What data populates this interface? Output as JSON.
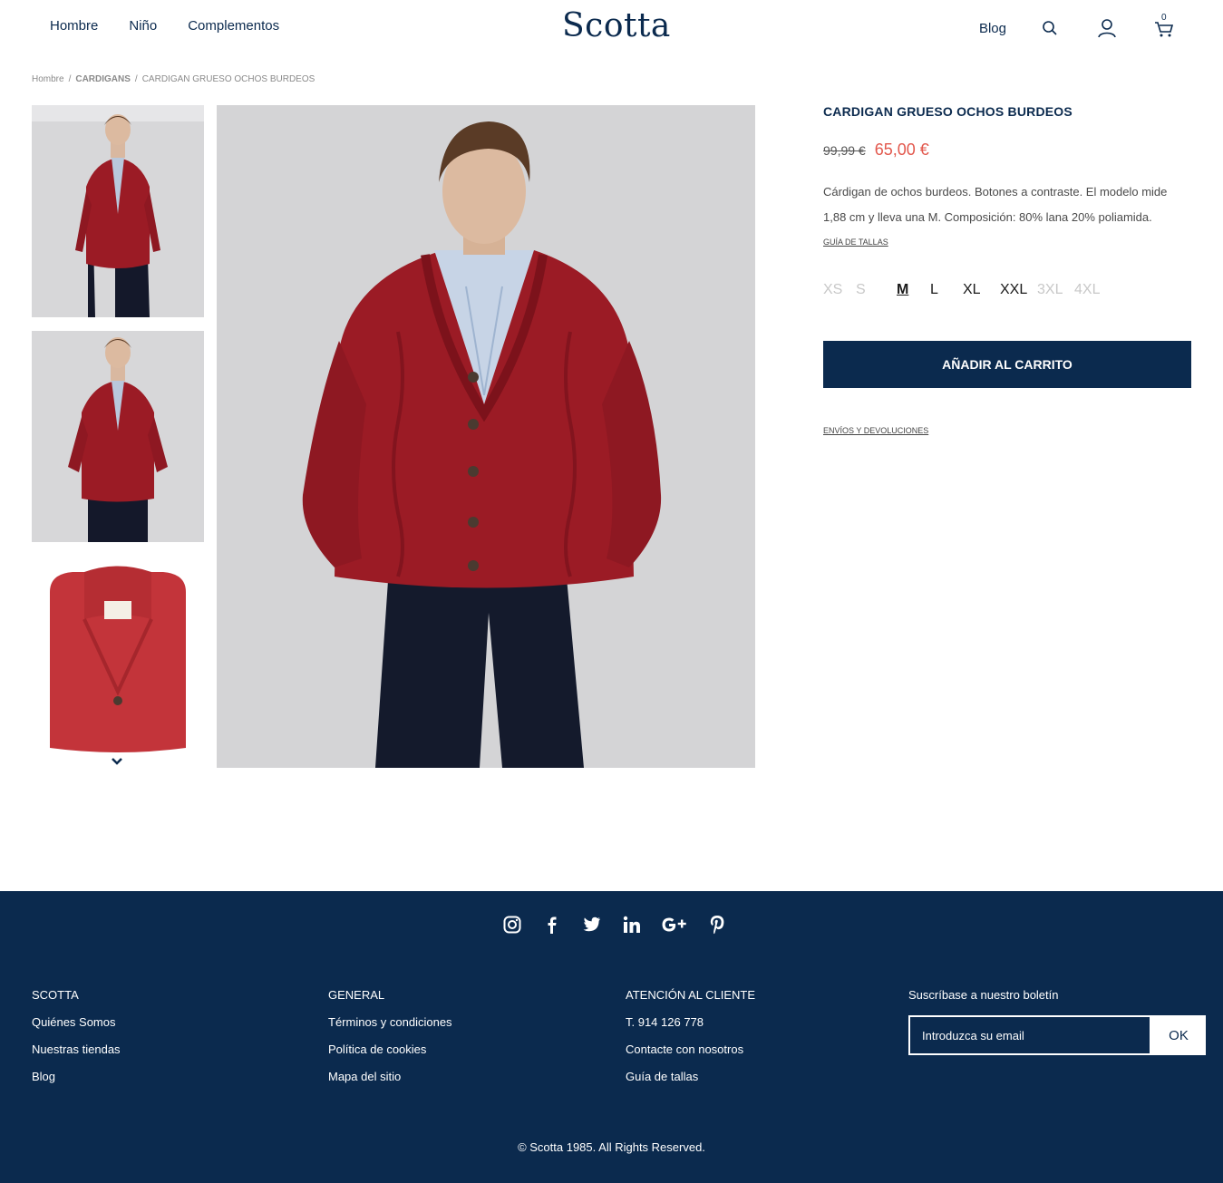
{
  "header": {
    "nav": [
      "Hombre",
      "Niño",
      "Complementos"
    ],
    "logo": "Scotta",
    "blog": "Blog",
    "cart_count": "0"
  },
  "breadcrumb": [
    "Hombre",
    "CARDIGANS",
    "CARDIGAN GRUESO OCHOS BURDEOS"
  ],
  "product": {
    "title": "CARDIGAN GRUESO OCHOS BURDEOS",
    "old_price": "99,99 €",
    "new_price": "65,00 €",
    "description": "Cárdigan de ochos burdeos. Botones a contraste. El modelo mide 1,88 cm y lleva una M. Composición: 80% lana 20% poliamida.",
    "size_guide_link": "GUÍA DE TALLAS",
    "sizes": [
      {
        "label": "XS",
        "state": "unavailable"
      },
      {
        "label": "S",
        "state": "unavailable"
      },
      {
        "label": "M",
        "state": "selected"
      },
      {
        "label": "L",
        "state": "available"
      },
      {
        "label": "XL",
        "state": "available"
      },
      {
        "label": "XXL",
        "state": "available"
      },
      {
        "label": "3XL",
        "state": "unavailable"
      },
      {
        "label": "4XL",
        "state": "unavailable"
      }
    ],
    "add_to_cart": "AÑADIR AL CARRITO",
    "shipping_link": "ENVÍOS Y DEVOLUCIONES"
  },
  "footer": {
    "social_icons": [
      "instagram-icon",
      "facebook-icon",
      "twitter-icon",
      "linkedin-icon",
      "google-plus-icon",
      "pinterest-icon"
    ],
    "col1": {
      "heading": "SCOTTA",
      "items": [
        "Quiénes Somos",
        "Nuestras tiendas",
        "Blog"
      ]
    },
    "col2": {
      "heading": "GENERAL",
      "items": [
        "Términos y condiciones",
        "Política de cookies",
        "Mapa del sitio"
      ]
    },
    "col3": {
      "heading": "ATENCIÓN AL CLIENTE",
      "items": [
        "T. 914 126 778",
        "Contacte con nosotros",
        "Guía de tallas"
      ]
    },
    "newsletter": {
      "heading": "Suscríbase a nuestro boletín",
      "placeholder": "Introduzca su email",
      "button": "OK"
    },
    "copyright": "© Scotta 1985. All Rights Reserved."
  },
  "colors": {
    "navy": "#0b2a4e",
    "sale_red": "#e2574c",
    "sweater_burgundy": "#9b1b25"
  }
}
